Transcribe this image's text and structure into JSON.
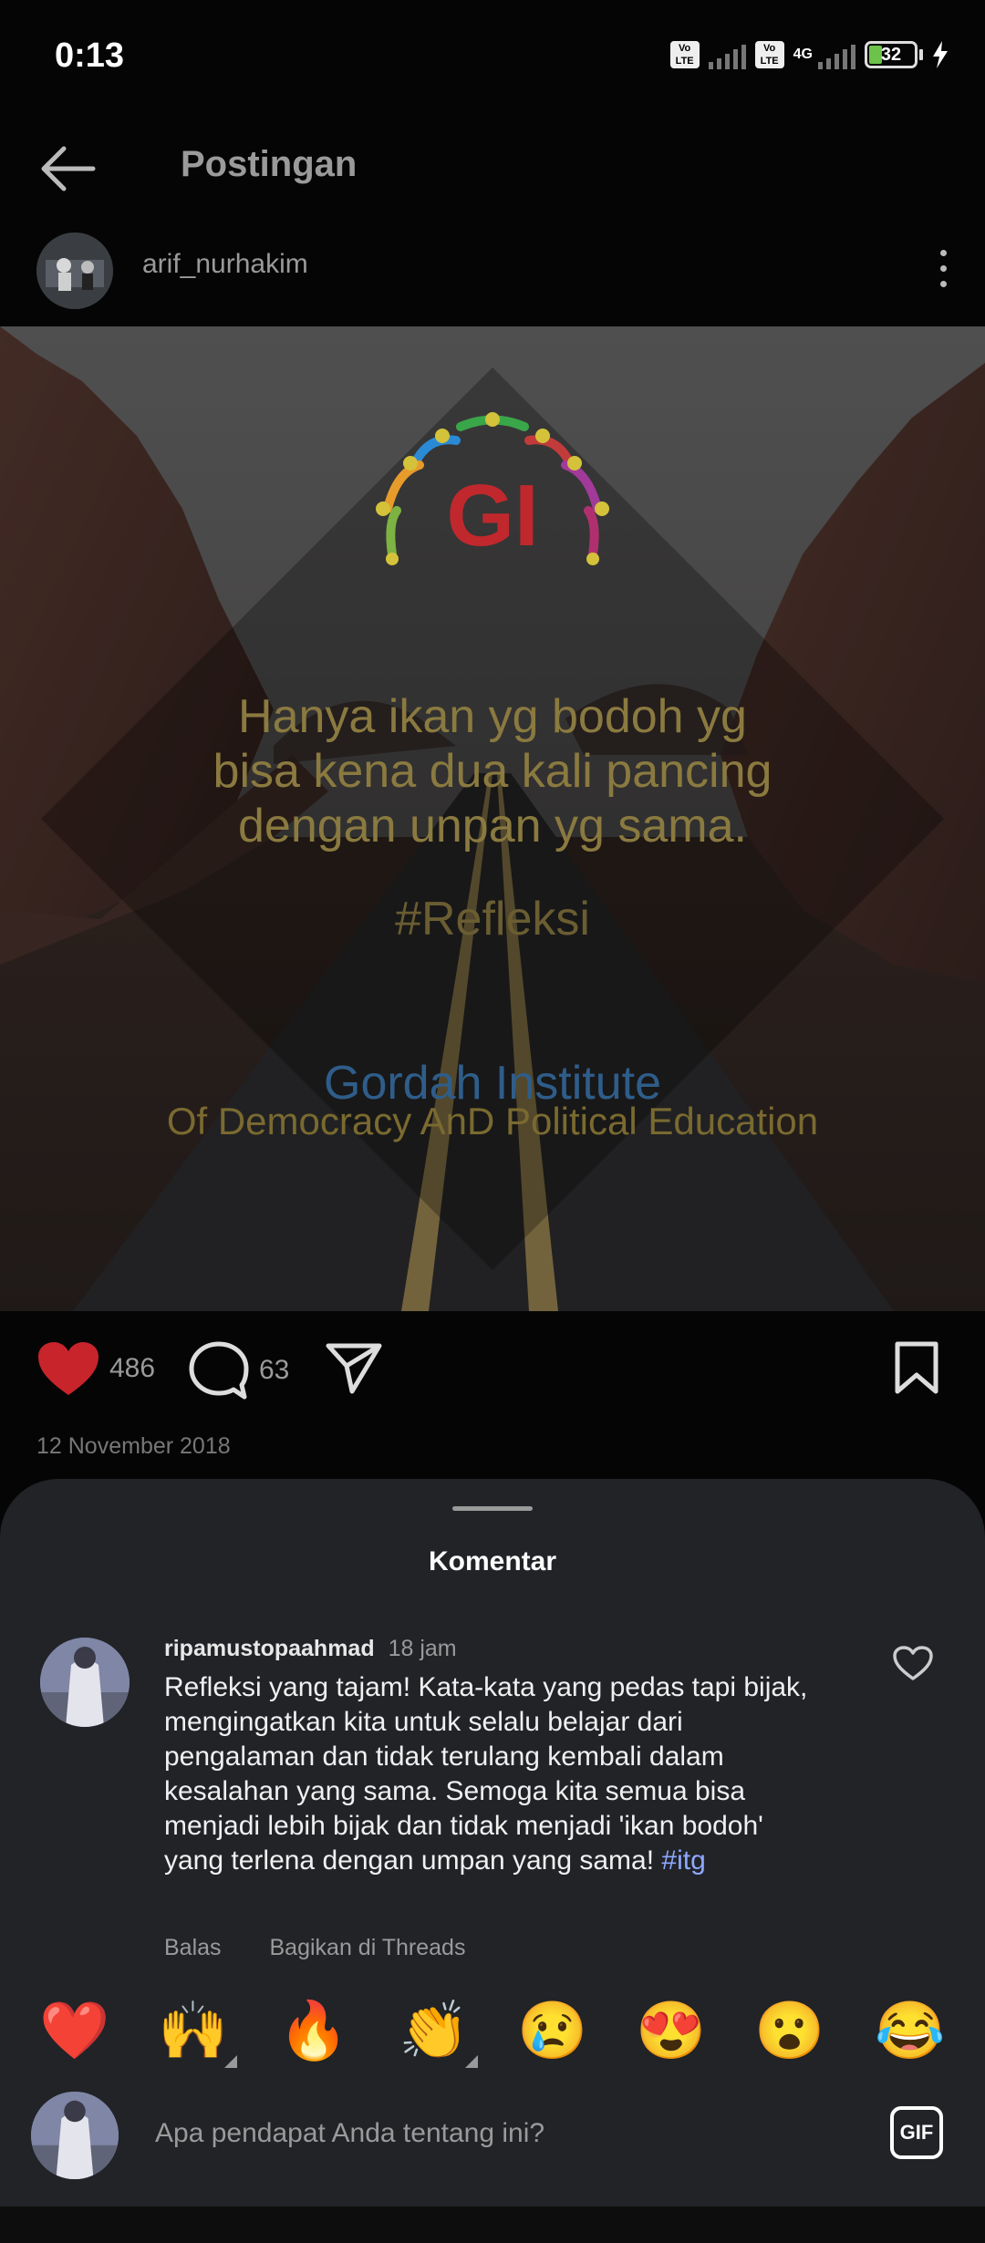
{
  "status_bar": {
    "time": "0:13",
    "volte_label": "Vo LTE",
    "network": "4G",
    "battery": "32"
  },
  "header": {
    "title": "Postingan"
  },
  "post": {
    "author": "arif_nurhakim",
    "image": {
      "logo_text": "GI",
      "quote_lines": [
        "Hanya ikan yg bodoh yg",
        "bisa kena dua kali pancing",
        "dengan unpan yg sama."
      ],
      "hashtag": "#Refleksi",
      "institute_name": "Gordah Institute",
      "institute_subtitle": "Of Democracy AnD Political Education"
    },
    "likes": "486",
    "comments": "63",
    "date": "12 November 2018"
  },
  "comments_sheet": {
    "title": "Komentar",
    "comment": {
      "user": "ripamustopaahmad",
      "time": "18 jam",
      "text_lines": [
        "Refleksi yang tajam!  Kata-kata yang pedas tapi bijak,",
        "mengingatkan kita untuk selalu belajar dari",
        "pengalaman dan tidak terulang kembali dalam",
        "kesalahan yang sama. Semoga kita semua bisa",
        "menjadi lebih bijak dan tidak menjadi 'ikan bodoh'",
        "yang terlena dengan umpan yang sama! "
      ],
      "tag": "#itg",
      "reply_label": "Balas",
      "share_label": "Bagikan di Threads"
    },
    "emojis": [
      "❤️",
      "🙌",
      "🔥",
      "👏",
      "😢",
      "😍",
      "😮",
      "😂"
    ],
    "input_placeholder": "Apa pendapat Anda tentang ini?",
    "gif_label": "GIF"
  }
}
